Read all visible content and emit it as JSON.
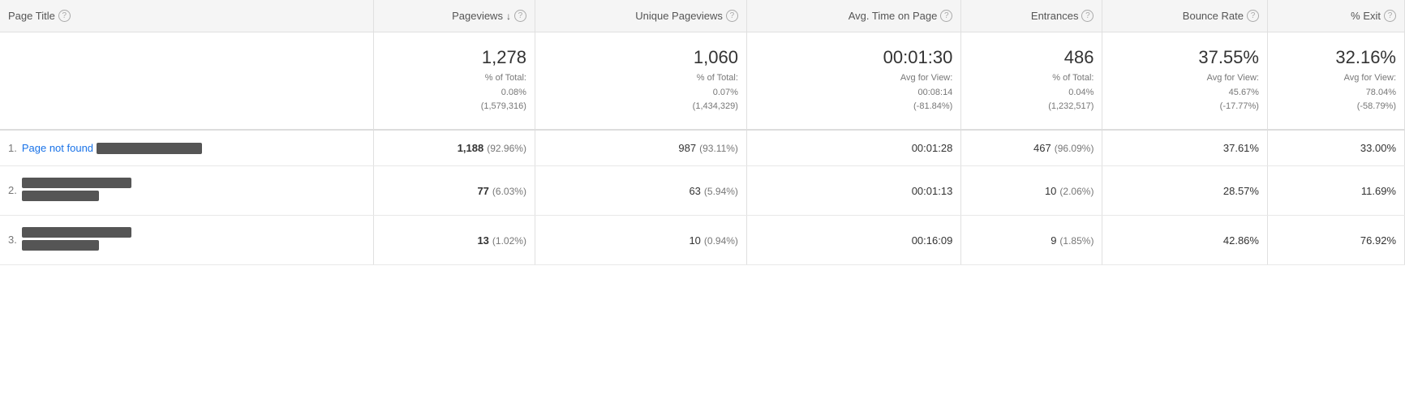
{
  "header": {
    "col_page_title": "Page Title",
    "col_pageviews": "Pageviews",
    "col_unique_pageviews": "Unique Pageviews",
    "col_avg_time": "Avg. Time on Page",
    "col_entrances": "Entrances",
    "col_bounce_rate": "Bounce Rate",
    "col_exit": "% Exit"
  },
  "summary": {
    "pageviews_main": "1,278",
    "pageviews_sub1": "% of Total:",
    "pageviews_sub2": "0.08%",
    "pageviews_sub3": "(1,579,316)",
    "unique_pv_main": "1,060",
    "unique_pv_sub1": "% of Total:",
    "unique_pv_sub2": "0.07%",
    "unique_pv_sub3": "(1,434,329)",
    "avg_time_main": "00:01:30",
    "avg_time_sub1": "Avg for View:",
    "avg_time_sub2": "00:08:14",
    "avg_time_sub3": "(-81.84%)",
    "entrances_main": "486",
    "entrances_sub1": "% of Total:",
    "entrances_sub2": "0.04%",
    "entrances_sub3": "(1,232,517)",
    "bounce_main": "37.55%",
    "bounce_sub1": "Avg for View:",
    "bounce_sub2": "45.67%",
    "bounce_sub3": "(-17.77%)",
    "exit_main": "32.16%",
    "exit_sub1": "Avg for View:",
    "exit_sub2": "78.04%",
    "exit_sub3": "(-58.79%)"
  },
  "rows": [
    {
      "num": "1.",
      "title": "Page not found",
      "redacted_width": 130,
      "pageviews": "1,188",
      "pv_pct": "(92.96%)",
      "unique_pv": "987",
      "upv_pct": "(93.11%)",
      "avg_time": "00:01:28",
      "entrances": "467",
      "ent_pct": "(96.09%)",
      "bounce": "37.61%",
      "exit": "33.00%"
    },
    {
      "num": "2.",
      "title": null,
      "redacted_width": 135,
      "pageviews": "77",
      "pv_pct": "(6.03%)",
      "unique_pv": "63",
      "upv_pct": "(5.94%)",
      "avg_time": "00:01:13",
      "entrances": "10",
      "ent_pct": "(2.06%)",
      "bounce": "28.57%",
      "exit": "11.69%"
    },
    {
      "num": "3.",
      "title": null,
      "redacted_width": 135,
      "pageviews": "13",
      "pv_pct": "(1.02%)",
      "unique_pv": "10",
      "upv_pct": "(0.94%)",
      "avg_time": "00:16:09",
      "entrances": "9",
      "ent_pct": "(1.85%)",
      "bounce": "42.86%",
      "exit": "76.92%"
    }
  ]
}
